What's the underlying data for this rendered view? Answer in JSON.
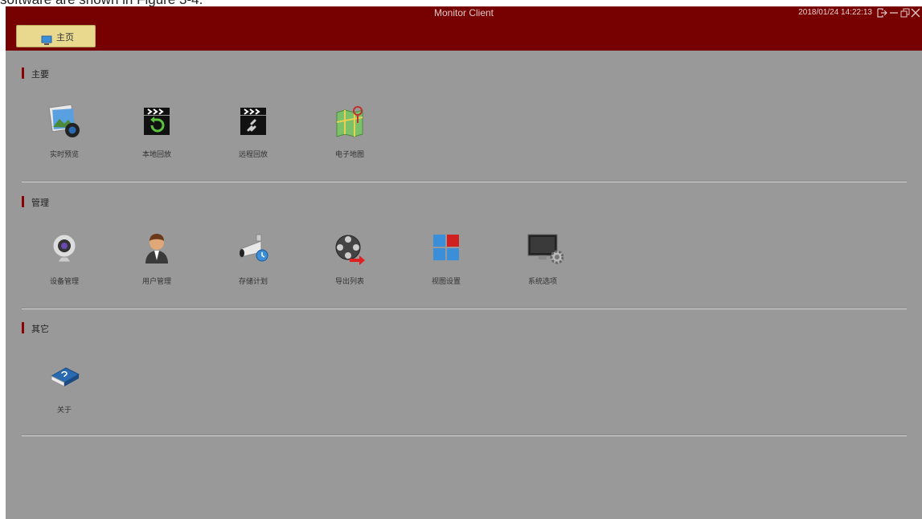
{
  "document": {
    "caption": "software are shown in Figure 3-4."
  },
  "window": {
    "title": "Monitor Client",
    "datetime": "2018/01/24 14:22:13",
    "home_tab": "主页"
  },
  "sections": [
    {
      "title": "主要",
      "items": [
        {
          "label": "实时预览",
          "icon": "live-preview-icon"
        },
        {
          "label": "本地回放",
          "icon": "local-playback-icon"
        },
        {
          "label": "远程回放",
          "icon": "remote-playback-icon"
        },
        {
          "label": "电子地图",
          "icon": "e-map-icon"
        }
      ]
    },
    {
      "title": "管理",
      "items": [
        {
          "label": "设备管理",
          "icon": "device-management-icon"
        },
        {
          "label": "用户管理",
          "icon": "user-management-icon"
        },
        {
          "label": "存储计划",
          "icon": "storage-plan-icon"
        },
        {
          "label": "导出列表",
          "icon": "export-list-icon"
        },
        {
          "label": "视图设置",
          "icon": "view-settings-icon"
        },
        {
          "label": "系统选项",
          "icon": "system-options-icon"
        }
      ]
    },
    {
      "title": "其它",
      "items": [
        {
          "label": "关于",
          "icon": "about-icon"
        }
      ]
    }
  ],
  "colors": {
    "titlebar": "#770000",
    "background": "#999999",
    "home_tab": "#e8d98e",
    "section_accent": "#8b0000"
  }
}
